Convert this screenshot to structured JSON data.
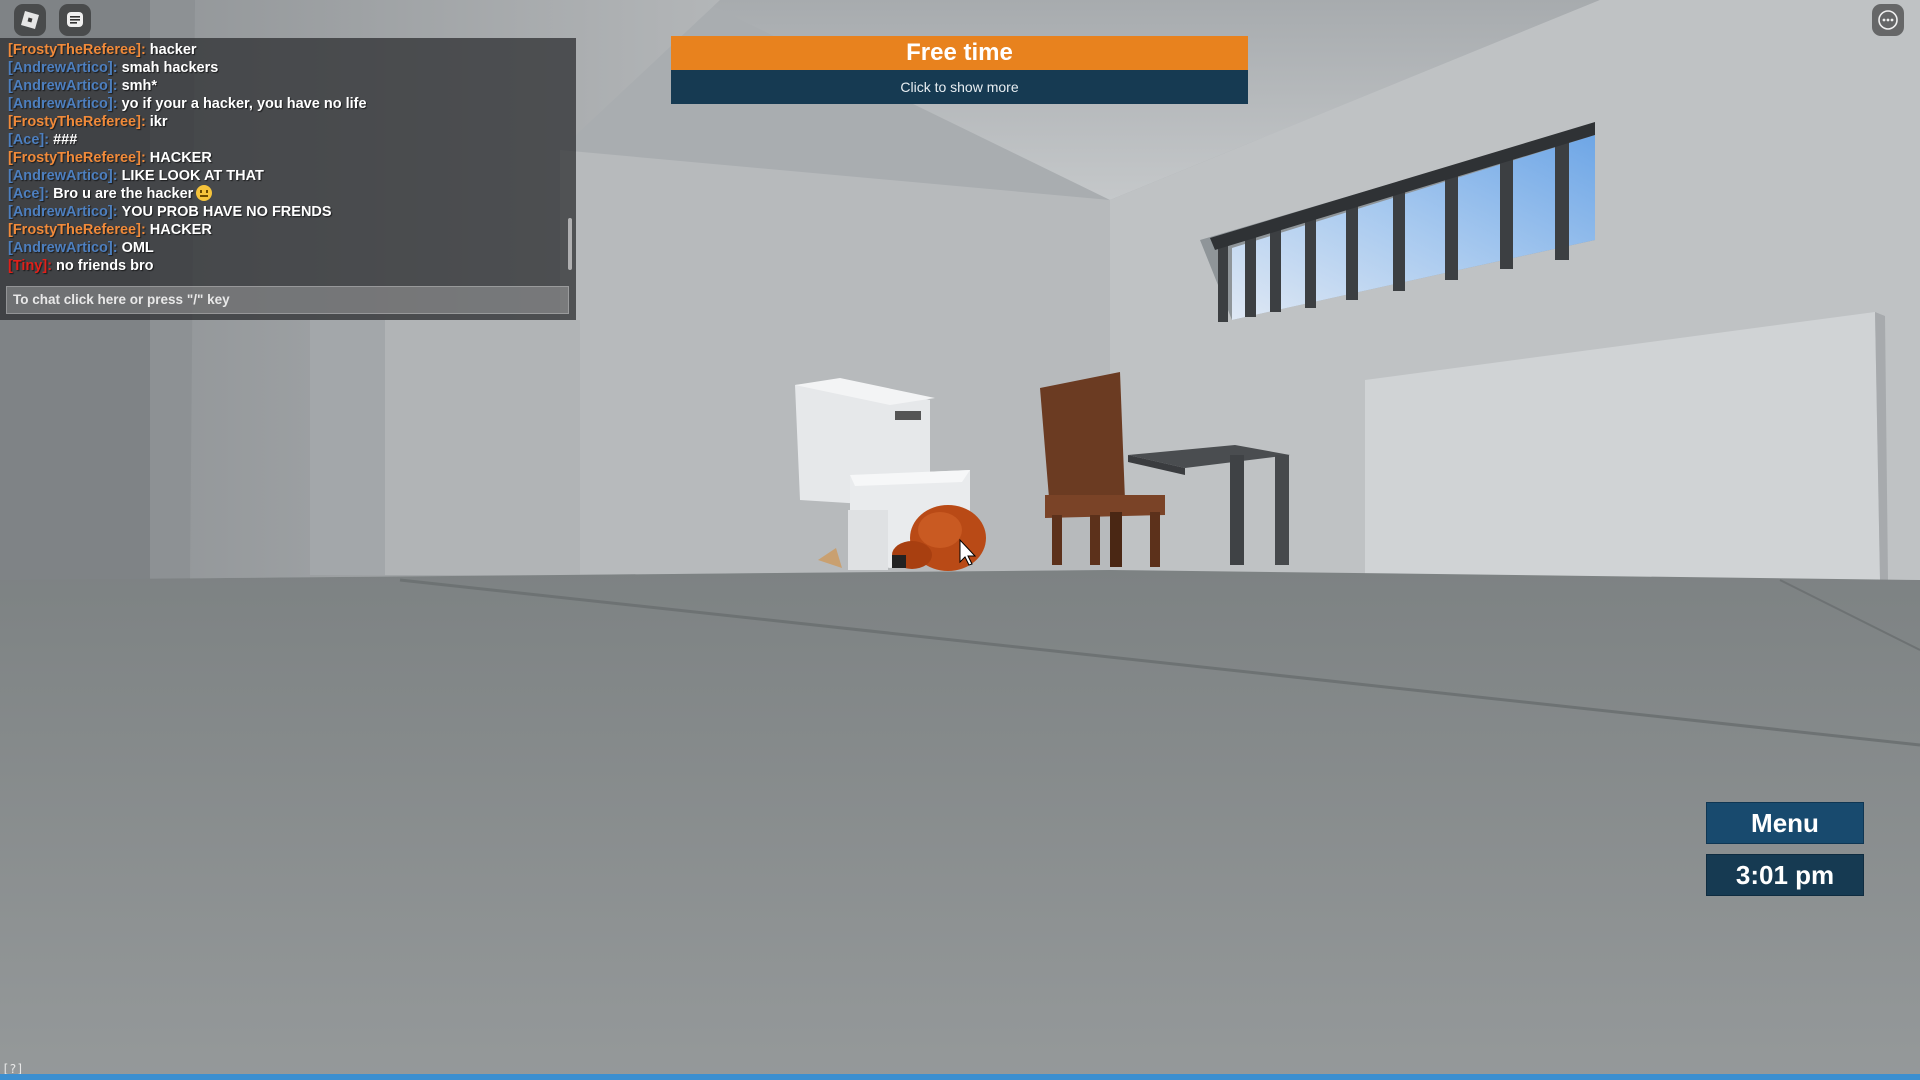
{
  "chat": {
    "messages": [
      {
        "name": "[FrostyTheReferee]:",
        "text": "hacker",
        "color": "#f08a3a"
      },
      {
        "name": "[AndrewArtico]:",
        "text": "smah hackers",
        "color": "#4d7fbf"
      },
      {
        "name": "[AndrewArtico]:",
        "text": "smh*",
        "color": "#4d7fbf"
      },
      {
        "name": "[AndrewArtico]:",
        "text": "yo if your a hacker, you have no life",
        "color": "#4d7fbf"
      },
      {
        "name": "[FrostyTheReferee]:",
        "text": "ikr",
        "color": "#f08a3a"
      },
      {
        "name": "[Ace]:",
        "text": "###",
        "color": "#4d7fbf"
      },
      {
        "name": "[FrostyTheReferee]:",
        "text": "HACKER",
        "color": "#f08a3a"
      },
      {
        "name": "[AndrewArtico]:",
        "text": "LIKE LOOK AT THAT",
        "color": "#4d7fbf"
      },
      {
        "name": "[Ace]:",
        "text": "Bro u are the hacker",
        "color": "#4d7fbf",
        "emoji": "smiley-emoji"
      },
      {
        "name": "[AndrewArtico]:",
        "text": "YOU PROB HAVE NO FRENDS",
        "color": "#4d7fbf"
      },
      {
        "name": "[FrostyTheReferee]:",
        "text": "HACKER",
        "color": "#f08a3a"
      },
      {
        "name": "[AndrewArtico]:",
        "text": "OML",
        "color": "#4d7fbf"
      },
      {
        "name": "[Tiny]:",
        "text": "no friends bro",
        "color": "#e0201a"
      }
    ],
    "input_placeholder": "To chat click here or press \"/\" key"
  },
  "banner": {
    "title": "Free time",
    "subtitle": "Click to show more",
    "title_color": "#e8821e",
    "subtitle_color": "#163a52"
  },
  "hud": {
    "menu_label": "Menu",
    "clock": "3:01 pm"
  },
  "footer": {
    "help_label": "[?]"
  },
  "icons": {
    "roblox": "roblox-logo-icon",
    "chat": "chat-icon",
    "more": "more-options-icon"
  }
}
